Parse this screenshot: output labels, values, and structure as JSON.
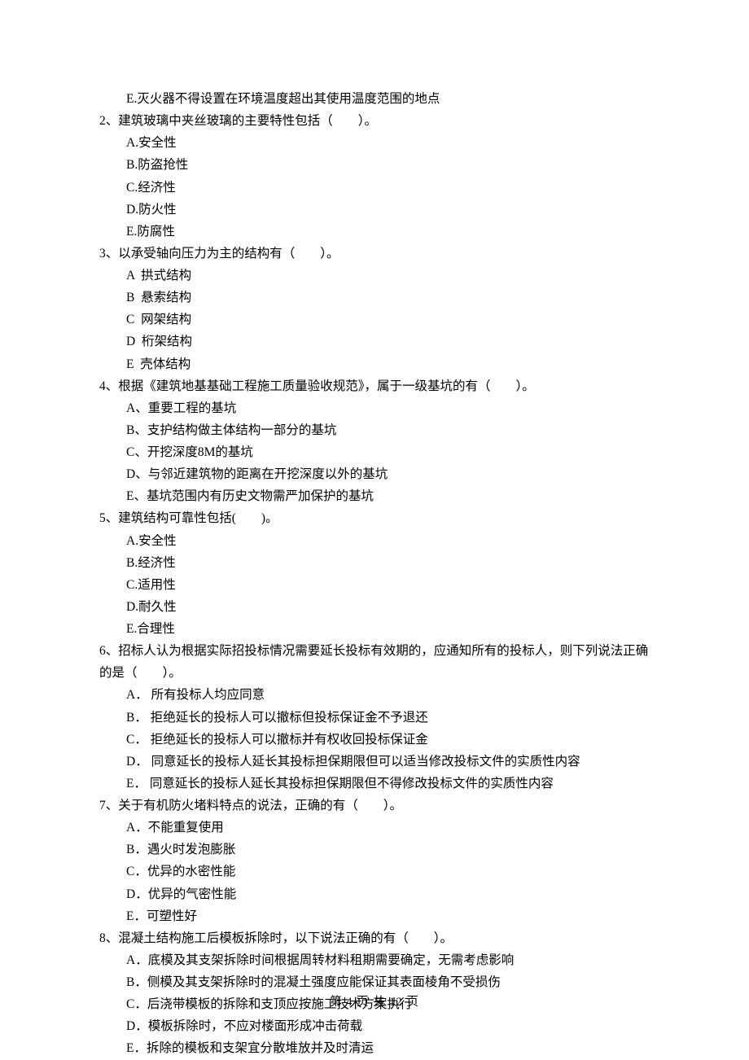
{
  "lead_option_e": "E.灭火器不得设置在环境温度超出其使用温度范围的地点",
  "questions": [
    {
      "stem": "2、建筑玻璃中夹丝玻璃的主要特性包括（　　）。",
      "options": [
        "A.安全性",
        "B.防盗抢性",
        "C.经济性",
        "D.防火性",
        "E.防腐性"
      ]
    },
    {
      "stem": "3、以承受轴向压力为主的结构有（　　）。",
      "options": [
        "A  拱式结构",
        "B  悬索结构",
        "C  网架结构",
        "D  桁架结构",
        "E  壳体结构"
      ]
    },
    {
      "stem": "4、根据《建筑地基基础工程施工质量验收规范》，属于一级基坑的有（　　）。",
      "options": [
        "A、重要工程的基坑",
        "B、支护结构做主体结构一部分的基坑",
        "C、开挖深度8M的基坑",
        "D、与邻近建筑物的距离在开挖深度以外的基坑",
        "E、基坑范围内有历史文物需严加保护的基坑"
      ]
    },
    {
      "stem": "5、建筑结构可靠性包括(　　)。",
      "options": [
        "A.安全性",
        "B.经济性",
        "C.适用性",
        "D.耐久性",
        "E.合理性"
      ]
    },
    {
      "stem": "6、招标人认为根据实际招投标情况需要延长投标有效期的，应通知所有的投标人，则下列说法正确的是（　　）。",
      "options": [
        "A． 所有投标人均应同意",
        "B． 拒绝延长的投标人可以撤标但投标保证金不予退还",
        "C． 拒绝延长的投标人可以撤标并有权收回投标保证金",
        "D． 同意延长的投标人延长其投标担保期限但可以适当修改投标文件的实质性内容",
        "E． 同意延长的投标人延长其投标担保期限但不得修改投标文件的实质性内容"
      ]
    },
    {
      "stem": "7、关于有机防火堵料特点的说法，正确的有（　　）。",
      "options": [
        "A．不能重复使用",
        "B．遇火时发泡膨胀",
        "C．优异的水密性能",
        "D．优异的气密性能",
        "E．可塑性好"
      ]
    },
    {
      "stem": "8、混凝土结构施工后模板拆除时，以下说法正确的有（　　）。",
      "options": [
        "A．底模及其支架拆除时间根据周转材料租期需要确定，无需考虑影响",
        "B．侧模及其支架拆除时的混凝土强度应能保证其表面棱角不受损伤",
        "C．后浇带模板的拆除和支顶应按施工技术方案执行",
        "D．模板拆除时，不应对楼面形成冲击荷载",
        "E．拆除的模板和支架宜分散堆放并及时清运"
      ]
    }
  ],
  "footer": "第 4 页 共 12 页"
}
